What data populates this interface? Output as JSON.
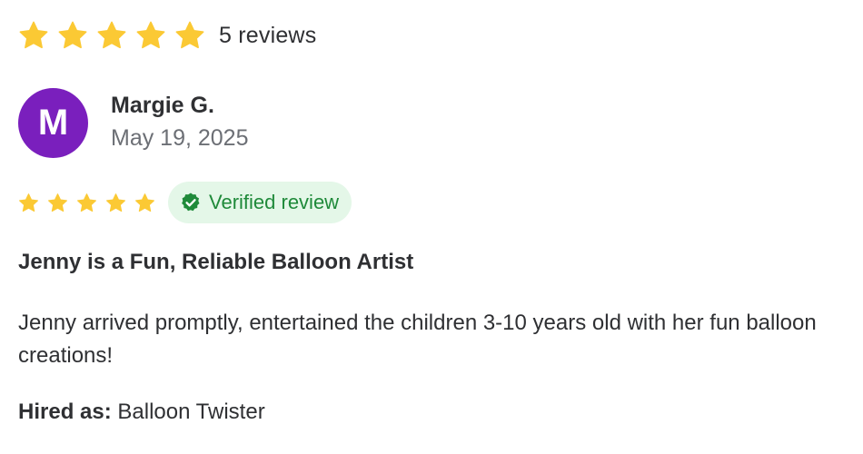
{
  "colors": {
    "star": "#fbc934",
    "avatar_bg": "#7a1fbd",
    "verified_bg": "#e4f7e8",
    "verified_text": "#1f8a3a"
  },
  "summary": {
    "rating": 5,
    "max_rating": 5,
    "count_text": "5 reviews"
  },
  "review": {
    "avatar_initial": "M",
    "reviewer_name": "Margie G.",
    "date": "May 19, 2025",
    "rating": 5,
    "max_rating": 5,
    "verified_label": "Verified review",
    "title": "Jenny is a Fun, Reliable Balloon Artist",
    "body": "Jenny arrived promptly, entertained the children 3-10 years old with her fun balloon creations!",
    "hired_label": "Hired as:",
    "hired_value": "Balloon Twister"
  },
  "icons": {
    "star": "star-icon",
    "verified": "verified-check-icon"
  }
}
